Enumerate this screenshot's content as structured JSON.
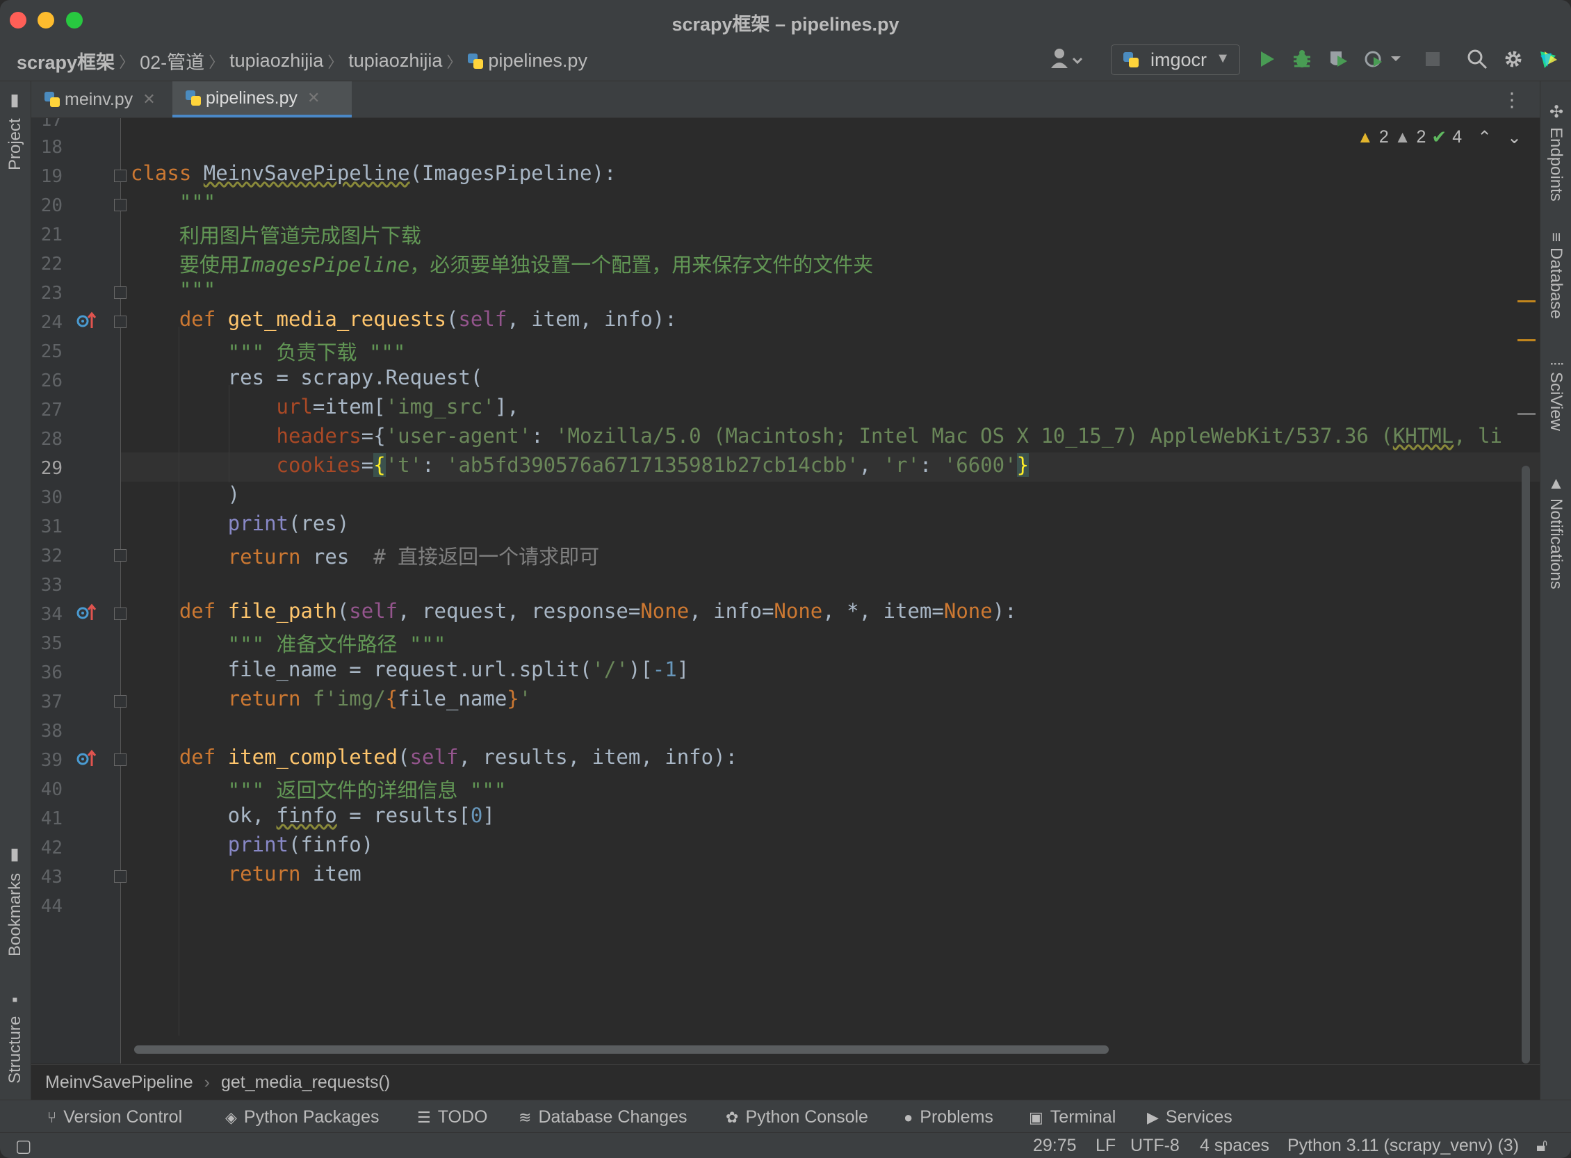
{
  "window": {
    "title": "scrapy框架 – pipelines.py"
  },
  "breadcrumbs": [
    "scrapy框架",
    "02-管道",
    "tupiaozhijia",
    "tupiaozhijia",
    "pipelines.py"
  ],
  "run_config": {
    "name": "imgocr"
  },
  "tabs": [
    {
      "label": "meinv.py",
      "active": false
    },
    {
      "label": "pipelines.py",
      "active": true
    }
  ],
  "left_panels": [
    "Project",
    "Bookmarks",
    "Structure"
  ],
  "right_panels": [
    "Endpoints",
    "Database",
    "SciView",
    "Notifications"
  ],
  "inspections": {
    "warnings": "2",
    "weak_warnings": "2",
    "ok": "4"
  },
  "code": {
    "first_visible_line": "17",
    "current_line": "29",
    "lines": [
      {
        "n": "18"
      },
      {
        "n": "19"
      },
      {
        "n": "20"
      },
      {
        "n": "21"
      },
      {
        "n": "22"
      },
      {
        "n": "23"
      },
      {
        "n": "24"
      },
      {
        "n": "25"
      },
      {
        "n": "26"
      },
      {
        "n": "27"
      },
      {
        "n": "28"
      },
      {
        "n": "29"
      },
      {
        "n": "30"
      },
      {
        "n": "31"
      },
      {
        "n": "32"
      },
      {
        "n": "33"
      },
      {
        "n": "34"
      },
      {
        "n": "35"
      },
      {
        "n": "36"
      },
      {
        "n": "37"
      },
      {
        "n": "38"
      },
      {
        "n": "39"
      },
      {
        "n": "40"
      },
      {
        "n": "41"
      },
      {
        "n": "42"
      },
      {
        "n": "43"
      },
      {
        "n": "44"
      }
    ],
    "text": {
      "l19_kw": "class ",
      "l19_name": "MeinvSavePipeline",
      "l19_rest": "(ImagesPipeline):",
      "l20": "    \"\"\"",
      "l21": "    利用图片管道完成图片下载",
      "l22_a": "    要使用",
      "l22_b": "ImagesPipeline",
      "l22_c": "，必须要单独设置一个配置，用来保存文件的文件夹",
      "l23": "    \"\"\"",
      "l24_kw": "    def ",
      "l24_fn": "get_media_requests",
      "l24_p1": "(",
      "l24_self": "self",
      "l24_rest1": ", item, info):",
      "l25": "        \"\"\" 负责下载 \"\"\"",
      "l26": "        res = scrapy.Request(",
      "l27_pre": "            ",
      "l27_param": "url",
      "l27_mid": "=item[",
      "l27_str": "'img_src'",
      "l27_end": "],",
      "l28_pre": "            ",
      "l28_param": "headers",
      "l28_mid": "={",
      "l28_k": "'user-agent'",
      "l28_c": ": ",
      "l28_v": "'Mozilla/5.0 (Macintosh; Intel Mac OS X 10_15_7) AppleWebKit/537.36 (",
      "l28_vu": "KHTML",
      "l28_v2": ", li",
      "l29_pre": "            ",
      "l29_param": "cookies",
      "l29_eq": "=",
      "l29_ob": "{",
      "l29_k1": "'t'",
      "l29_c1": ": ",
      "l29_v1": "'ab5fd390576a6717135981b27cb14cbb'",
      "l29_c2": ", ",
      "l29_k2": "'r'",
      "l29_c3": ": ",
      "l29_v2": "'6600'",
      "l29_cb": "}",
      "l30": "        )",
      "l31_pre": "        ",
      "l31_bi": "print",
      "l31_rest": "(res)",
      "l32_pre": "        ",
      "l32_kw": "return",
      "l32_rest": " res  ",
      "l32_cm": "# 直接返回一个请求即可",
      "l34_kw": "    def ",
      "l34_fn": "file_path",
      "l34_p": "(",
      "l34_self": "self",
      "l34_a": ", request, response=",
      "l34_n1": "None",
      "l34_b": ", info=",
      "l34_n2": "None",
      "l34_c": ", *, item=",
      "l34_n3": "None",
      "l34_d": "):",
      "l35": "        \"\"\" 准备文件路径 \"\"\"",
      "l36_a": "        file_name = request.url.split(",
      "l36_s": "'/'",
      "l36_b": ")[",
      "l36_n": "-1",
      "l36_c": "]",
      "l37_pre": "        ",
      "l37_kw": "return ",
      "l37_s1": "f'img/",
      "l37_ob": "{",
      "l37_v": "file_name",
      "l37_cb": "}",
      "l37_s2": "'",
      "l39_kw": "    def ",
      "l39_fn": "item_completed",
      "l39_p": "(",
      "l39_self": "self",
      "l39_rest": ", results, item, info):",
      "l40": "        \"\"\" 返回文件的详细信息 \"\"\"",
      "l41_a": "        ok, ",
      "l41_u": "finfo",
      "l41_b": " = results[",
      "l41_n": "0",
      "l41_c": "]",
      "l42_pre": "        ",
      "l42_bi": "print",
      "l42_rest": "(finfo)",
      "l43_pre": "        ",
      "l43_kw": "return",
      "l43_rest": " item"
    }
  },
  "editor_breadcrumbs": [
    "MeinvSavePipeline",
    "get_media_requests()"
  ],
  "tool_windows": [
    "Version Control",
    "Python Packages",
    "TODO",
    "Database Changes",
    "Python Console",
    "Problems",
    "Terminal",
    "Services"
  ],
  "status": {
    "position": "29:75",
    "line_sep": "LF",
    "encoding": "UTF-8",
    "indent": "4 spaces",
    "interpreter": "Python 3.11 (scrapy_venv) (3)"
  },
  "colors": {
    "accent": "#4a88c7",
    "run": "#499c54",
    "warning": "#e2b52d"
  }
}
